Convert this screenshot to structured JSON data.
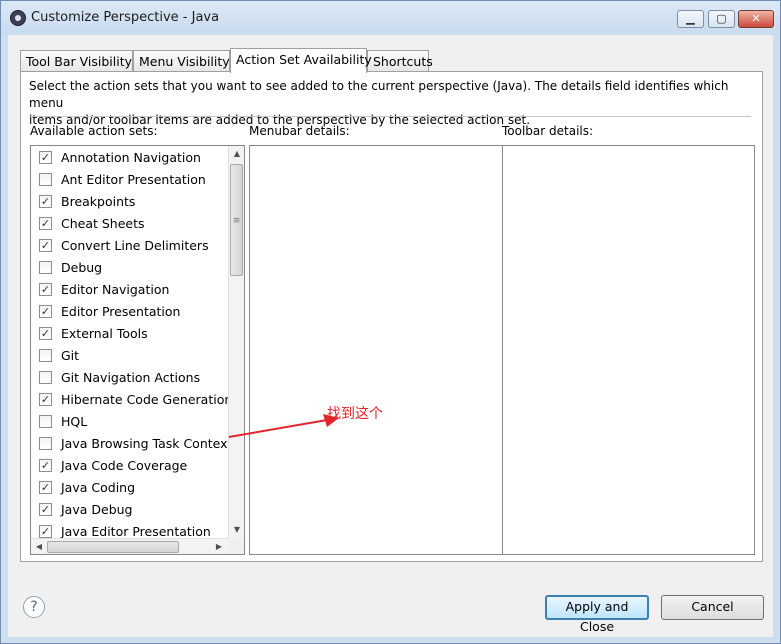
{
  "window": {
    "title": "Customize Perspective - Java"
  },
  "tabs": [
    {
      "label": "Tool Bar Visibility"
    },
    {
      "label": "Menu Visibility"
    },
    {
      "label": "Action Set Availability"
    },
    {
      "label": "Shortcuts"
    }
  ],
  "active_tab": "Action Set Availability",
  "panel": {
    "description_line1": "Select the action sets that you want to see added to the current perspective (Java).  The details field identifies which menu",
    "description_line2": "items and/or toolbar items are added to the perspective by the selected action set.",
    "available_label": "Available action sets:",
    "menubar_label": "Menubar details:",
    "toolbar_label": "Toolbar details:"
  },
  "action_sets": [
    {
      "label": "Annotation Navigation",
      "checked": true
    },
    {
      "label": "Ant Editor Presentation",
      "checked": false
    },
    {
      "label": "Breakpoints",
      "checked": true
    },
    {
      "label": "Cheat Sheets",
      "checked": true
    },
    {
      "label": "Convert Line Delimiters",
      "checked": true
    },
    {
      "label": "Debug",
      "checked": false
    },
    {
      "label": "Editor Navigation",
      "checked": true
    },
    {
      "label": "Editor Presentation",
      "checked": true
    },
    {
      "label": "External Tools",
      "checked": true
    },
    {
      "label": "Git",
      "checked": false
    },
    {
      "label": "Git Navigation Actions",
      "checked": false
    },
    {
      "label": "Hibernate Code Generation",
      "checked": true
    },
    {
      "label": "HQL",
      "checked": false
    },
    {
      "label": "Java Browsing Task Context",
      "checked": false
    },
    {
      "label": "Java Code Coverage",
      "checked": true
    },
    {
      "label": "Java Coding",
      "checked": true
    },
    {
      "label": "Java Debug",
      "checked": true
    },
    {
      "label": "Java Editor Presentation",
      "checked": true
    }
  ],
  "annotation": {
    "text": "找到这个",
    "color": "#e0262a"
  },
  "buttons": {
    "apply_close": "Apply and Close",
    "cancel": "Cancel",
    "help": "?"
  },
  "titlebar_buttons": {
    "minimize": "▁",
    "maximize": "▢",
    "close": "✕"
  }
}
